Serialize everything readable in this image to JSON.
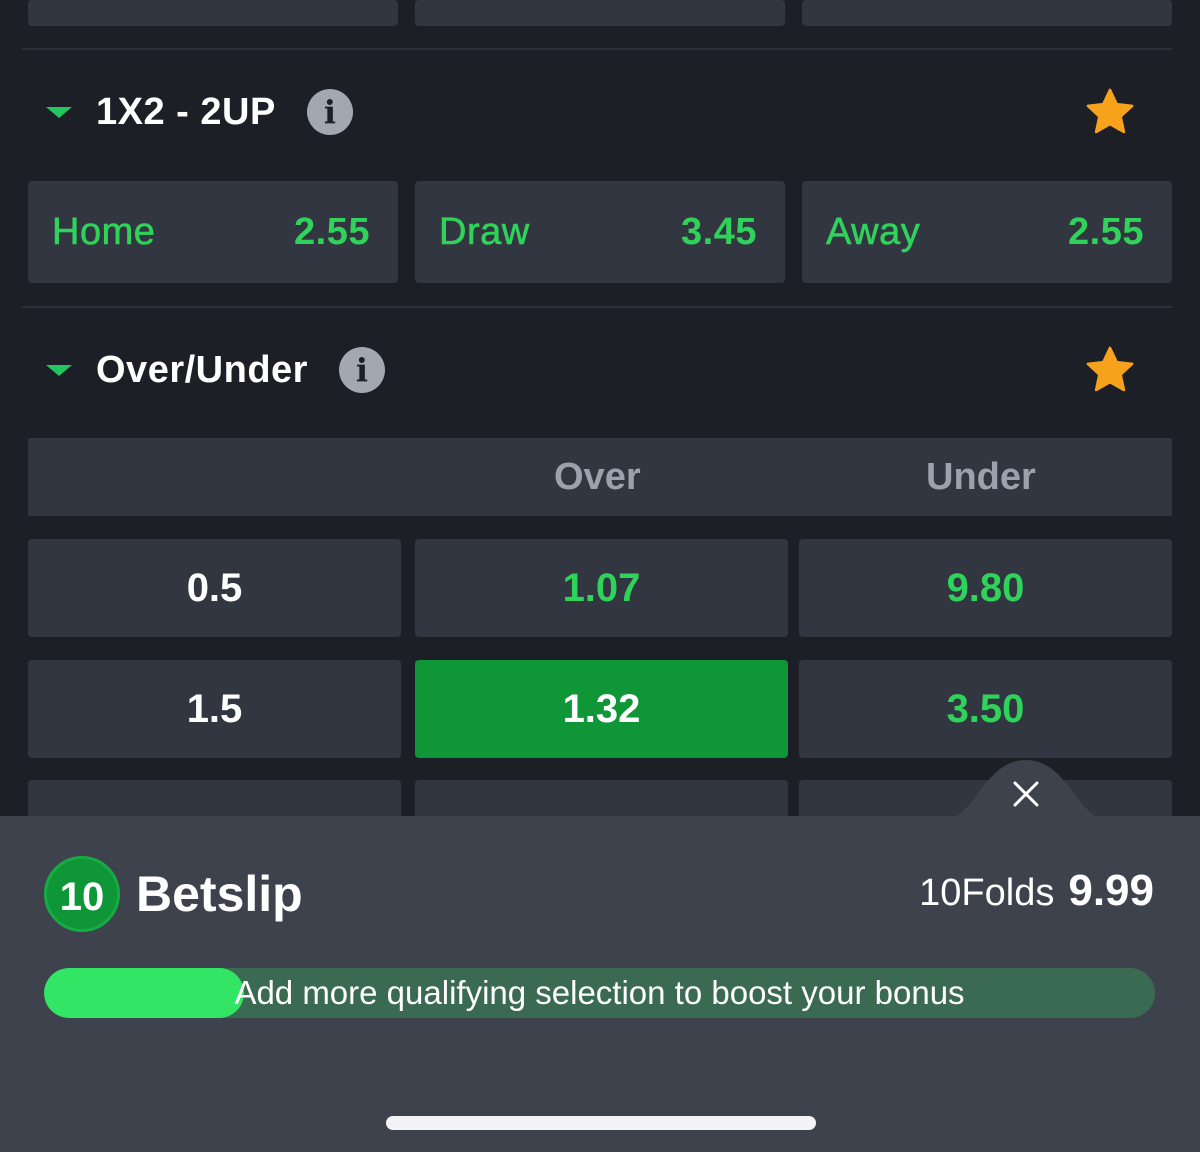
{
  "market_1x2": {
    "title": "1X2 - 2UP",
    "info_icon": "info-icon",
    "star_icon": "star-icon",
    "options": [
      {
        "label": "Home",
        "odds": "2.55"
      },
      {
        "label": "Draw",
        "odds": "3.45"
      },
      {
        "label": "Away",
        "odds": "2.55"
      }
    ]
  },
  "market_ou": {
    "title": "Over/Under",
    "info_icon": "info-icon",
    "star_icon": "star-icon",
    "col_over": "Over",
    "col_under": "Under",
    "rows": [
      {
        "line": "0.5",
        "over": "1.07",
        "under": "9.80",
        "selected": "none"
      },
      {
        "line": "1.5",
        "over": "1.32",
        "under": "3.50",
        "selected": "over"
      }
    ]
  },
  "betslip": {
    "count": "10",
    "title": "Betslip",
    "folds_label": "10Folds",
    "folds_value": "9.99",
    "progress_fraction": 0.18,
    "progress_text": "Add more qualifying selection to boost your bonus",
    "close_icon": "close-icon"
  },
  "colors": {
    "accent_green": "#2fd35a",
    "selected_green": "#0e9637",
    "star_orange": "#f7a21b",
    "background": "#1c1f26",
    "cell": "#323641"
  }
}
